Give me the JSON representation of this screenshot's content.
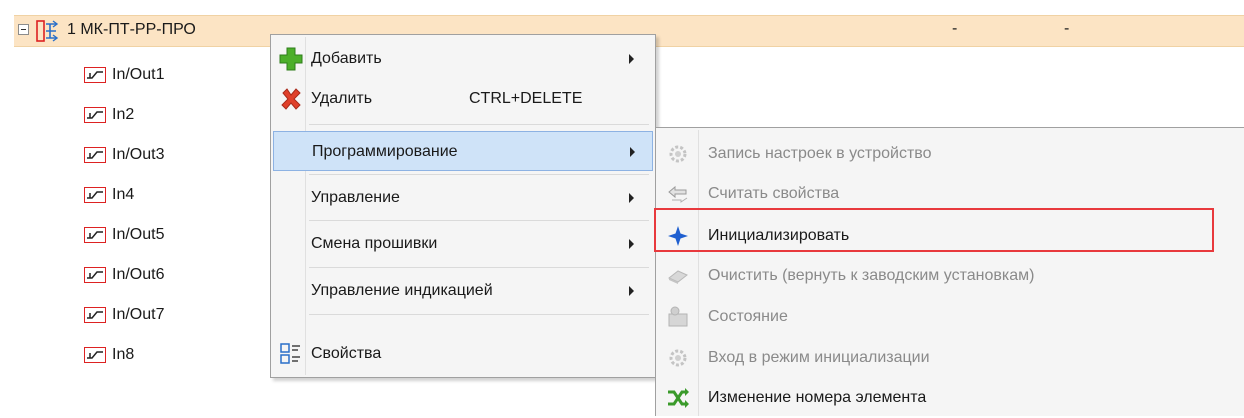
{
  "tree": {
    "device": {
      "label": "1 МК-ПТ-РР-ПРО",
      "column1": "-",
      "column2": "-"
    },
    "children": [
      {
        "label": "In/Out1"
      },
      {
        "label": "In2"
      },
      {
        "label": "In/Out3"
      },
      {
        "label": "In4"
      },
      {
        "label": "In/Out5"
      },
      {
        "label": "In/Out6"
      },
      {
        "label": "In/Out7"
      },
      {
        "label": "In8"
      }
    ]
  },
  "context_menu": {
    "items": [
      {
        "label": "Добавить",
        "icon": "green-plus-icon",
        "has_submenu": true
      },
      {
        "label": "Удалить",
        "shortcut": "CTRL+DELETE",
        "icon": "red-x-icon"
      },
      {
        "label": "Программирование",
        "has_submenu": true,
        "highlighted": true
      },
      {
        "label": "Управление",
        "has_submenu": true
      },
      {
        "label": "Смена прошивки",
        "has_submenu": true
      },
      {
        "label": "Управление индикацией",
        "has_submenu": true
      },
      {
        "label": "Свойства",
        "icon": "properties-icon"
      }
    ]
  },
  "submenu": {
    "items": [
      {
        "label": "Запись настроек в устройство",
        "icon": "write-gear-icon",
        "enabled": false
      },
      {
        "label": "Считать свойства",
        "icon": "read-arrows-icon",
        "enabled": false
      },
      {
        "label": "Инициализировать",
        "icon": "blue-star-icon",
        "enabled": true
      },
      {
        "label": "Очистить (вернуть к заводским установкам)",
        "icon": "eraser-icon",
        "enabled": false
      },
      {
        "label": "Состояние",
        "icon": "status-icon",
        "enabled": false
      },
      {
        "label": "Вход в режим инициализации",
        "icon": "init-mode-icon",
        "enabled": false
      },
      {
        "label": "Изменение номера элемента",
        "icon": "green-swap-icon",
        "enabled": true
      }
    ]
  },
  "colors": {
    "selection_row": "#fce4c4",
    "menu_highlight": "#cfe3f8",
    "annotation_box": "#e8393d",
    "io_icon": "#dd2222"
  }
}
